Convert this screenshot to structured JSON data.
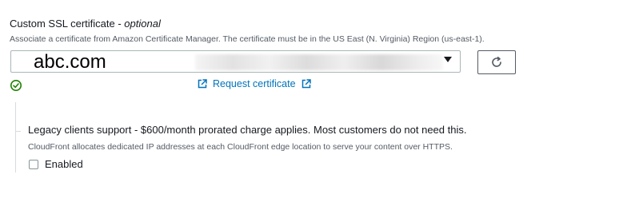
{
  "ssl": {
    "title": "Custom SSL certificate - ",
    "title_optional": "optional",
    "description": "Associate a certificate from Amazon Certificate Manager. The certificate must be in the US East (N. Virginia) Region (us-east-1).",
    "selected_value": "abc.com",
    "request_link_label": "Request certificate"
  },
  "legacy": {
    "title": "Legacy clients support - $600/month prorated charge applies. Most customers do not need this.",
    "description": "CloudFront allocates dedicated IP addresses at each CloudFront edge location to serve your content over HTTPS.",
    "enabled_label": "Enabled",
    "enabled_checked": false
  },
  "colors": {
    "link": "#0073bb",
    "success": "#1d8102",
    "muted_text": "#545b64"
  },
  "icons": {
    "refresh": "refresh-icon",
    "status": "check-circle-icon",
    "external": "external-link-icon",
    "dropdown": "caret-down-icon"
  }
}
